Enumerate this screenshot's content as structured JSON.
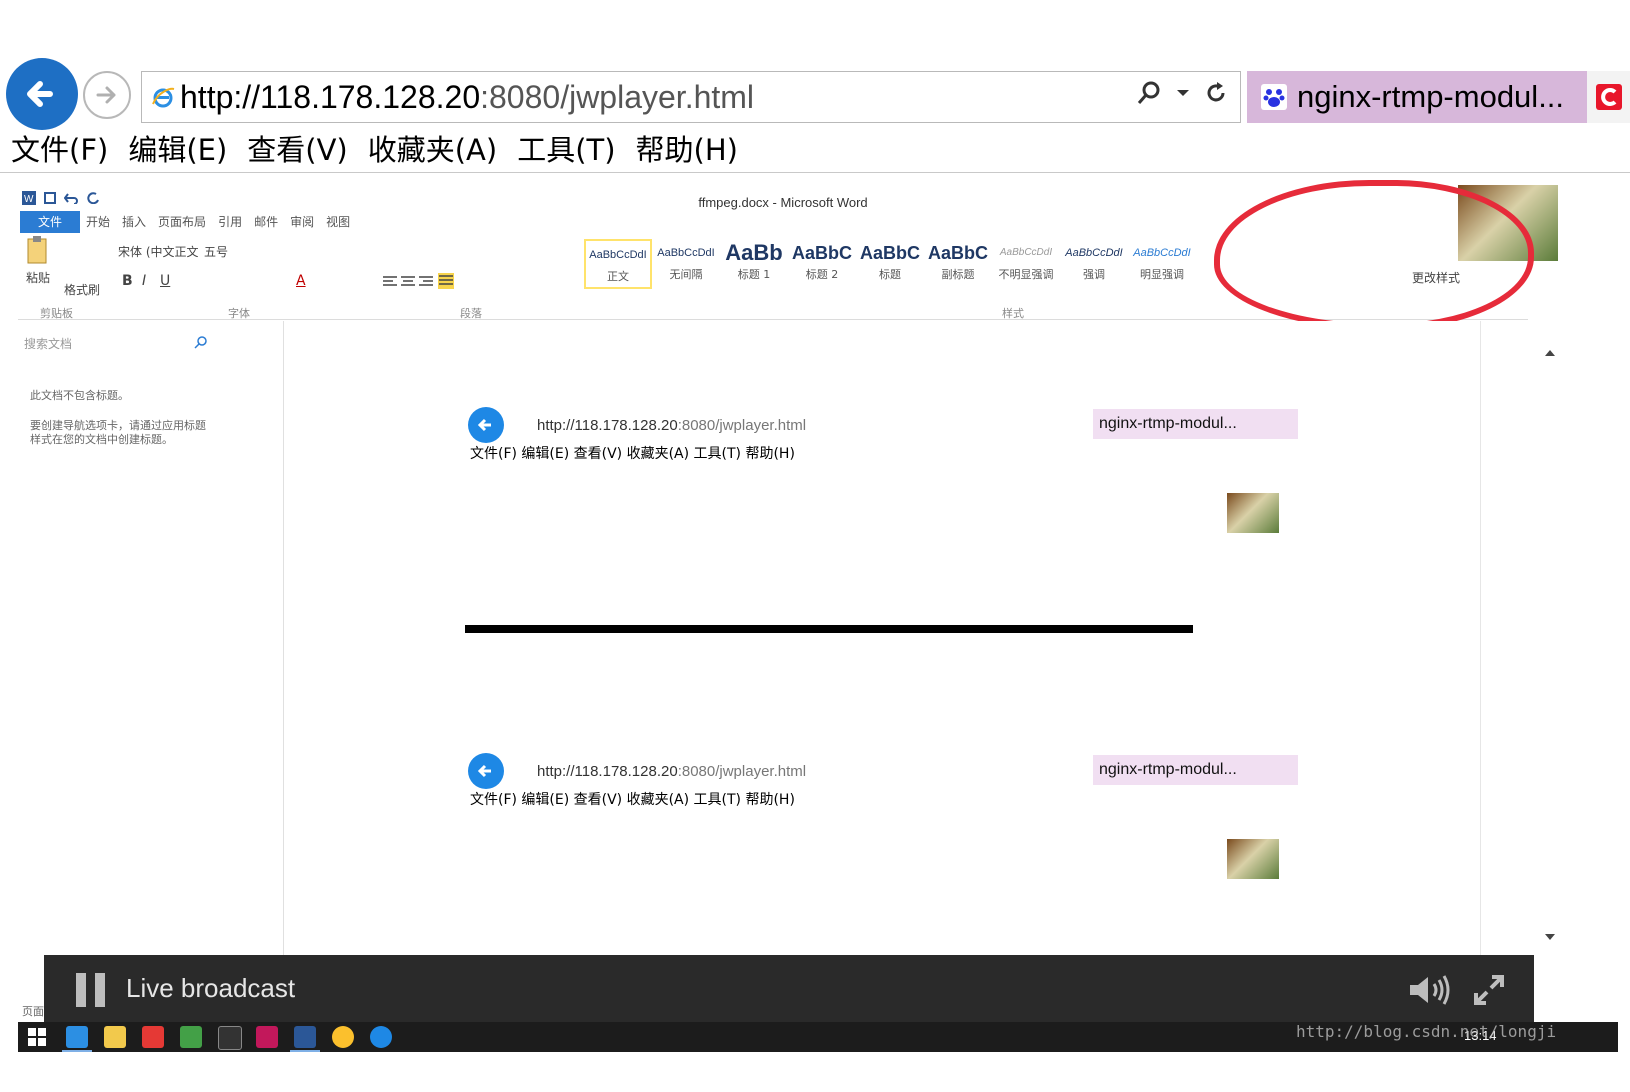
{
  "browser": {
    "url_host": "http://118.178.128.20",
    "url_rest": ":8080/jwplayer.html",
    "tab_title": "nginx-rtmp-modul...",
    "menu": [
      "文件(F)",
      "编辑(E)",
      "查看(V)",
      "收藏夹(A)",
      "工具(T)",
      "帮助(H)"
    ],
    "icons": [
      "back-arrow-icon",
      "forward-arrow-icon",
      "ie-logo-icon",
      "search-icon",
      "dropdown-icon",
      "refresh-icon",
      "baidu-paw-icon"
    ],
    "colors": {
      "back": "#1e6fc4",
      "tab": "#d7b7da",
      "close_red": "#e8172b"
    }
  },
  "word": {
    "title": "ffmpeg.docx - Microsoft Word",
    "tabs": [
      "文件",
      "开始",
      "插入",
      "页面布局",
      "引用",
      "邮件",
      "审阅",
      "视图"
    ],
    "font_name": "宋体 (中文正文",
    "font_size": "五号",
    "clipboard": {
      "paste": "粘贴",
      "format_painter": "格式刷"
    },
    "groups": [
      "剪贴板",
      "字体",
      "段落",
      "样式"
    ],
    "styles": [
      {
        "sample": "AaBbCcDdI",
        "name": "正文"
      },
      {
        "sample": "AaBbCcDdI",
        "name": "无间隔"
      },
      {
        "sample": "AaBb",
        "name": "标题 1"
      },
      {
        "sample": "AaBbC",
        "name": "标题 2"
      },
      {
        "sample": "AaBbC",
        "name": "标题"
      },
      {
        "sample": "AaBbC",
        "name": "副标题"
      },
      {
        "sample": "AaBbCcDdI",
        "name": "不明显强调"
      },
      {
        "sample": "AaBbCcDdI",
        "name": "强调"
      },
      {
        "sample": "AaBbCcDdI",
        "name": "明显强调"
      }
    ],
    "change_styles": "更改样式",
    "nav": {
      "search_placeholder": "搜索文档",
      "no_headings": "此文档不包含标题。",
      "hint": "要创建导航选项卡，请通过应用标题样式在您的文档中创建标题。"
    },
    "status": "页面"
  },
  "embedded": {
    "url_host": "http://118.178.128.20",
    "url_rest": ":8080/jwplayer.html",
    "tab_title": "nginx-rtmp-modul...",
    "menu": "文件(F)  编辑(E)  查看(V)  收藏夹(A)  工具(T)  帮助(H)"
  },
  "player": {
    "title": "Live broadcast",
    "icons": [
      "pause-icon",
      "volume-icon",
      "fullscreen-icon"
    ]
  },
  "taskbar": {
    "clock": "13:14"
  },
  "watermark": "http://blog.csdn.net/longji"
}
